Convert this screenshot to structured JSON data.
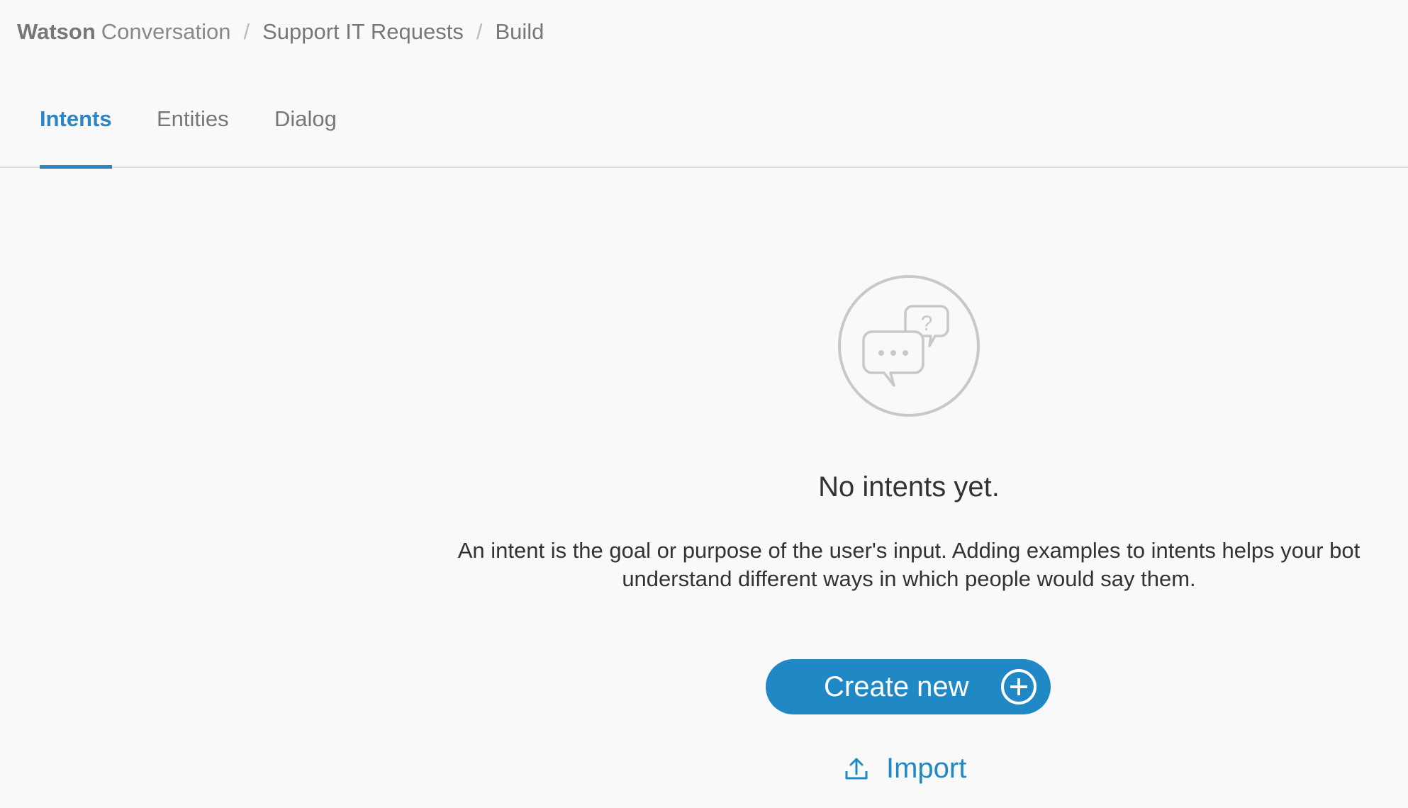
{
  "breadcrumb": {
    "brand_bold": "Watson",
    "brand_light": "Conversation",
    "separator": "/",
    "workspace": "Support IT Requests",
    "section": "Build"
  },
  "tabs": [
    {
      "label": "Intents",
      "active": true
    },
    {
      "label": "Entities",
      "active": false
    },
    {
      "label": "Dialog",
      "active": false
    }
  ],
  "empty_state": {
    "icon": "chat-bubbles-question-icon",
    "title": "No intents yet.",
    "description": "An intent is the goal or purpose of the user's input. Adding examples to intents helps your bot understand different ways in which people would say them.",
    "create_label": "Create new",
    "create_icon": "plus-circle-icon",
    "import_label": "Import",
    "import_icon": "upload-icon"
  },
  "colors": {
    "accent": "#2188c6",
    "tab_active": "#2d86c3",
    "background": "#f9f9f9"
  }
}
